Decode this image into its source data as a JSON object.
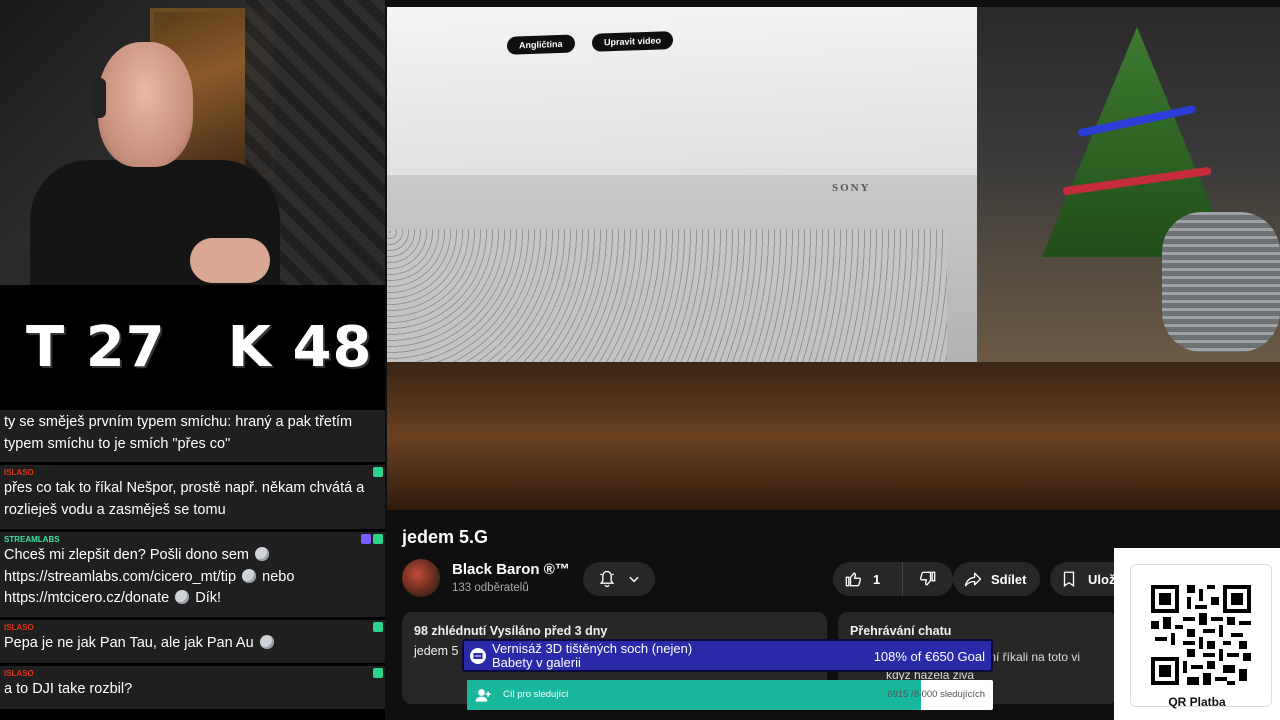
{
  "counters": {
    "t": "T 27",
    "k": "K 48"
  },
  "chat": [
    {
      "author": "",
      "author_color": "#ffffff",
      "text": "ty se směješ prvním typem smíchu: hraný a pak třetím typem smíchu to je smích \"přes co\""
    },
    {
      "author": "ISLASO",
      "author_color": "#e0341a",
      "text": "přes co tak to říkal Nešpor, prostě např. někam chvátá a rozlieješ vodu a zasměješ se tomu"
    },
    {
      "author": "STREAMLABS",
      "author_color": "#3fe0a0",
      "text_parts": [
        "Chceš mi zlepšit den? Pošli dono sem",
        "https://streamlabs.com/cicero_mt/tip",
        "nebo",
        "https://mtcicero.cz/donate",
        "Dík!"
      ]
    },
    {
      "author": "ISLASO",
      "author_color": "#e0341a",
      "text": "Pepa je ne jak Pan Tau, ale jak Pan Au"
    },
    {
      "author": "ISLASO",
      "author_color": "#e0341a",
      "text": "a to DJI take rozbil?"
    }
  ],
  "video": {
    "screen_chips": [
      "Angličtina",
      "Upravit video"
    ],
    "brand": "SONY"
  },
  "yt": {
    "title": "jedem 5.G",
    "channel_name": "Black Baron ®™",
    "subscribers": "133 odběratelů",
    "likes": "1",
    "share_label": "Sdílet",
    "save_label": "Ulož",
    "desc_stats": "98 zhlédnutí  Vysíláno před 3 dny",
    "desc_text": "jedem 5",
    "chat_replay_title": "Přehrávání chatu",
    "chat_replay_lines": [
      "statní říkali na toto vi",
      "když hážela živá"
    ]
  },
  "goal": {
    "title_line1": "Vernisáž 3D tištěných soch (nejen)",
    "title_line2": "Babety v galerii",
    "amount": "108% of €650 Goal"
  },
  "follower_goal": {
    "label": "Cíl pro sledující",
    "count": "6915 /8 000 sledujících",
    "progress": 0.864
  },
  "qr": {
    "label": "QR Platba"
  },
  "colors": {
    "badge_green": "#2bd48a",
    "badge_purple": "#7a5cff",
    "goal_blue": "#2a2aa8",
    "follower_teal": "#19b89e"
  }
}
